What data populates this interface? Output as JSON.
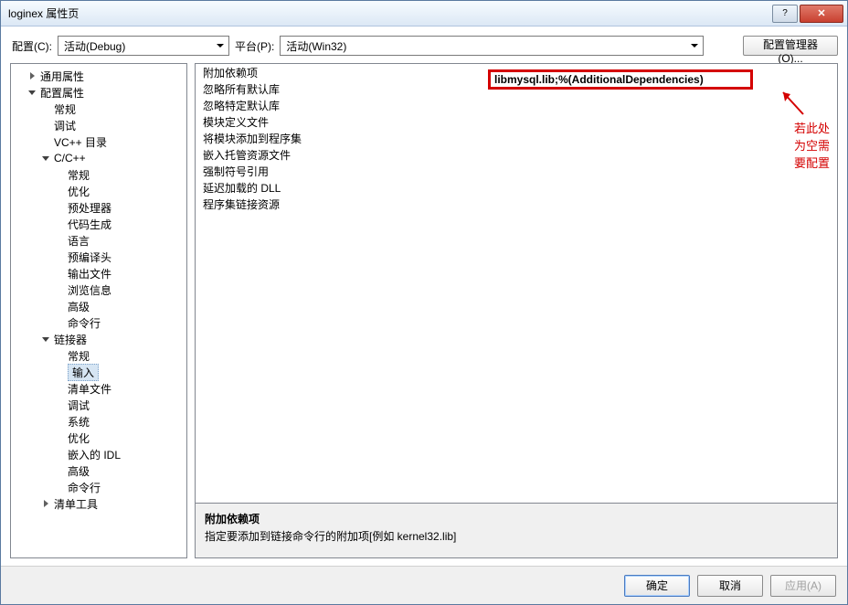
{
  "window": {
    "title": "loginex 属性页",
    "help_label": "?",
    "close_label": "✕"
  },
  "toolbar": {
    "config_label": "配置(C):",
    "config_value": "活动(Debug)",
    "platform_label": "平台(P):",
    "platform_value": "活动(Win32)",
    "config_mgr_label": "配置管理器(O)..."
  },
  "tree": {
    "items": [
      {
        "label": "通用属性",
        "exp": "right",
        "indent": 1,
        "sel": false
      },
      {
        "label": "配置属性",
        "exp": "down",
        "indent": 1,
        "sel": false
      },
      {
        "label": "常规",
        "exp": "",
        "indent": 2,
        "sel": false
      },
      {
        "label": "调试",
        "exp": "",
        "indent": 2,
        "sel": false
      },
      {
        "label": "VC++ 目录",
        "exp": "",
        "indent": 2,
        "sel": false
      },
      {
        "label": "C/C++",
        "exp": "down",
        "indent": 2,
        "sel": false
      },
      {
        "label": "常规",
        "exp": "",
        "indent": 3,
        "sel": false
      },
      {
        "label": "优化",
        "exp": "",
        "indent": 3,
        "sel": false
      },
      {
        "label": "预处理器",
        "exp": "",
        "indent": 3,
        "sel": false
      },
      {
        "label": "代码生成",
        "exp": "",
        "indent": 3,
        "sel": false
      },
      {
        "label": "语言",
        "exp": "",
        "indent": 3,
        "sel": false
      },
      {
        "label": "预编译头",
        "exp": "",
        "indent": 3,
        "sel": false
      },
      {
        "label": "输出文件",
        "exp": "",
        "indent": 3,
        "sel": false
      },
      {
        "label": "浏览信息",
        "exp": "",
        "indent": 3,
        "sel": false
      },
      {
        "label": "高级",
        "exp": "",
        "indent": 3,
        "sel": false
      },
      {
        "label": "命令行",
        "exp": "",
        "indent": 3,
        "sel": false
      },
      {
        "label": "链接器",
        "exp": "down",
        "indent": 2,
        "sel": false
      },
      {
        "label": "常规",
        "exp": "",
        "indent": 3,
        "sel": false
      },
      {
        "label": "输入",
        "exp": "",
        "indent": 3,
        "sel": true
      },
      {
        "label": "清单文件",
        "exp": "",
        "indent": 3,
        "sel": false
      },
      {
        "label": "调试",
        "exp": "",
        "indent": 3,
        "sel": false
      },
      {
        "label": "系统",
        "exp": "",
        "indent": 3,
        "sel": false
      },
      {
        "label": "优化",
        "exp": "",
        "indent": 3,
        "sel": false
      },
      {
        "label": "嵌入的 IDL",
        "exp": "",
        "indent": 3,
        "sel": false
      },
      {
        "label": "高级",
        "exp": "",
        "indent": 3,
        "sel": false
      },
      {
        "label": "命令行",
        "exp": "",
        "indent": 3,
        "sel": false
      },
      {
        "label": "清单工具",
        "exp": "right",
        "indent": 2,
        "sel": false
      }
    ]
  },
  "grid": {
    "rows": [
      {
        "name": "附加依赖项",
        "value": "libmysql.lib;%(AdditionalDependencies)",
        "highlight": true
      },
      {
        "name": "忽略所有默认库",
        "value": ""
      },
      {
        "name": "忽略特定默认库",
        "value": ""
      },
      {
        "name": "模块定义文件",
        "value": ""
      },
      {
        "name": "将模块添加到程序集",
        "value": ""
      },
      {
        "name": "嵌入托管资源文件",
        "value": ""
      },
      {
        "name": "强制符号引用",
        "value": ""
      },
      {
        "name": "延迟加载的 DLL",
        "value": ""
      },
      {
        "name": "程序集链接资源",
        "value": ""
      }
    ]
  },
  "annotation": {
    "text": "若此处为空需要配置"
  },
  "description": {
    "title": "附加依赖项",
    "text": "指定要添加到链接命令行的附加项[例如 kernel32.lib]"
  },
  "footer": {
    "ok_label": "确定",
    "cancel_label": "取消",
    "apply_label": "应用(A)"
  }
}
